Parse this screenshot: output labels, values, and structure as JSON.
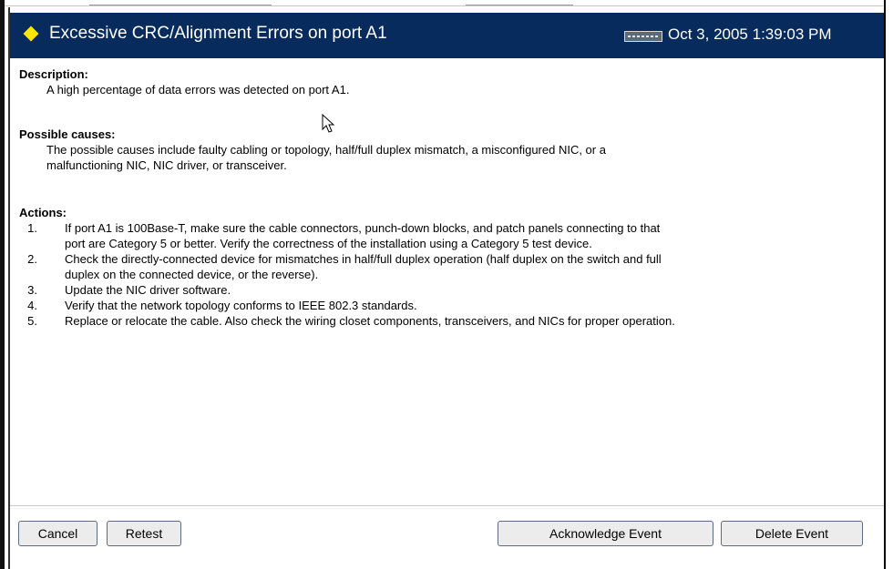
{
  "event": {
    "title": "Excessive CRC/Alignment Errors on port A1",
    "timestamp": "Oct 3, 2005 1:39:03 PM",
    "severity_icon": "yellow-diamond-icon",
    "device_icon": "switch-device-icon"
  },
  "description": {
    "heading": "Description:",
    "text": "A high percentage of data errors was detected on port A1."
  },
  "causes": {
    "heading": "Possible causes:",
    "line1": "The possible causes include faulty cabling or topology, half/full duplex mismatch, a misconfigured NIC, or a",
    "line2": "malfunctioning NIC, NIC driver, or transceiver."
  },
  "actions": {
    "heading": "Actions:",
    "items": [
      {
        "num": "1.",
        "line1": "If port A1 is 100Base-T, make sure the cable connectors, punch-down blocks, and patch panels connecting to that",
        "line2": "port are Category 5 or better. Verify the correctness of the installation using a Category 5 test device."
      },
      {
        "num": "2.",
        "line1": "Check the directly-connected device for mismatches in half/full duplex operation (half duplex on the switch and full",
        "line2": "duplex on the connected device, or the reverse)."
      },
      {
        "num": "3.",
        "line1": "Update the NIC driver software."
      },
      {
        "num": "4.",
        "line1": "Verify that the network topology conforms to IEEE 802.3 standards."
      },
      {
        "num": "5.",
        "line1": "Replace or relocate the cable. Also check the wiring closet components, transceivers, and NICs for proper operation."
      }
    ]
  },
  "buttons": {
    "cancel": "Cancel",
    "retest": "Retest",
    "acknowledge": "Acknowledge Event",
    "delete": "Delete Event"
  },
  "colors": {
    "header_bg": "#062b5c",
    "severity": "#ffe600"
  }
}
